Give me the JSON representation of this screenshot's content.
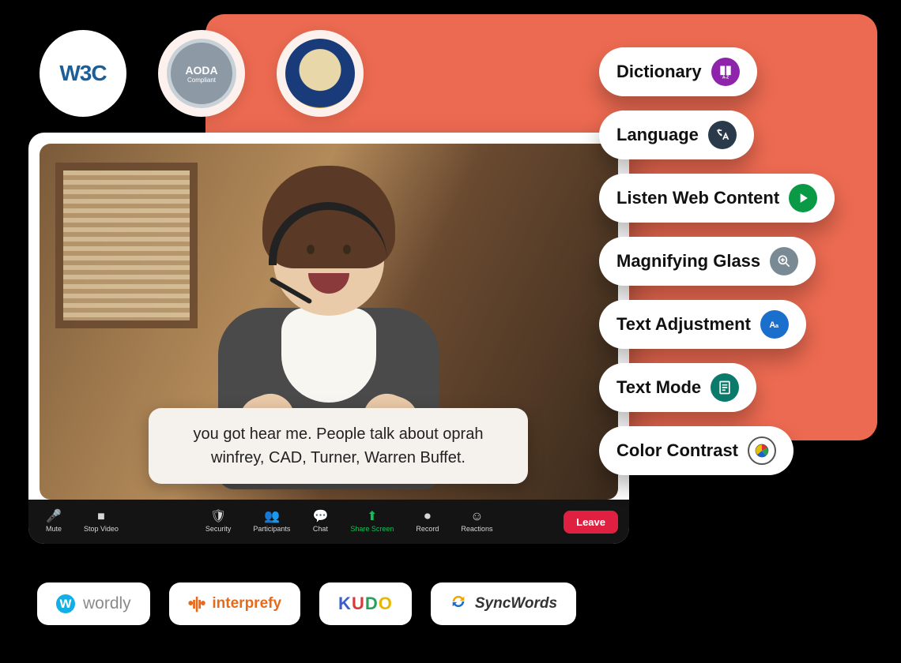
{
  "badges": {
    "w3c": "W3C",
    "aoda": "AODA",
    "aoda_sub": "Compliant",
    "doj_alt": "Department of Justice seal"
  },
  "video": {
    "caption": "you got hear me. People talk about oprah winfrey, CAD, Turner, Warren Buffet."
  },
  "zoom_controls": [
    {
      "name": "mute",
      "label": "Mute",
      "icon": "microphone-icon",
      "glyph": "🎤"
    },
    {
      "name": "stop-video",
      "label": "Stop Video",
      "icon": "camera-icon",
      "glyph": "■"
    },
    {
      "name": "security",
      "label": "Security",
      "icon": "shield-icon",
      "glyph": "🛡"
    },
    {
      "name": "participants",
      "label": "Participants",
      "icon": "people-icon",
      "glyph": "👥"
    },
    {
      "name": "chat",
      "label": "Chat",
      "icon": "chat-icon",
      "glyph": "💬"
    },
    {
      "name": "share-screen",
      "label": "Share Screen",
      "icon": "share-icon",
      "glyph": "⬆",
      "highlight": true
    },
    {
      "name": "record",
      "label": "Record",
      "icon": "record-icon",
      "glyph": "⏺"
    },
    {
      "name": "reactions",
      "label": "Reactions",
      "icon": "smile-icon",
      "glyph": "☺"
    }
  ],
  "leave_label": "Leave",
  "accessibility_pills": [
    {
      "name": "dictionary",
      "label": "Dictionary",
      "icon": "book-icon",
      "icon_bg": "#8e24aa"
    },
    {
      "name": "language",
      "label": "Language",
      "icon": "translate-icon",
      "icon_bg": "#2a3a4a"
    },
    {
      "name": "listen",
      "label": "Listen Web Content",
      "icon": "play-icon",
      "icon_bg": "#0a9a46"
    },
    {
      "name": "magnify",
      "label": "Magnifying Glass",
      "icon": "magnify-icon",
      "icon_bg": "#7a8a94"
    },
    {
      "name": "text-adjust",
      "label": "Text Adjustment",
      "icon": "text-aa-icon",
      "icon_bg": "#1a6ecc"
    },
    {
      "name": "text-mode",
      "label": "Text Mode",
      "icon": "document-icon",
      "icon_bg": "#0a7a6a"
    },
    {
      "name": "contrast",
      "label": "Color Contrast",
      "icon": "palette-icon",
      "icon_bg": "#555",
      "wheel": true
    }
  ],
  "integrations": [
    {
      "name": "wordly",
      "label": "wordly",
      "icon_bg": "#12aee6"
    },
    {
      "name": "interprefy",
      "label": "interprefy",
      "icon_bg": "#e66a1a"
    },
    {
      "name": "kudo",
      "label": "KUDO"
    },
    {
      "name": "syncwords",
      "label": "SyncWords",
      "icon_bg": "#f0a500"
    }
  ]
}
